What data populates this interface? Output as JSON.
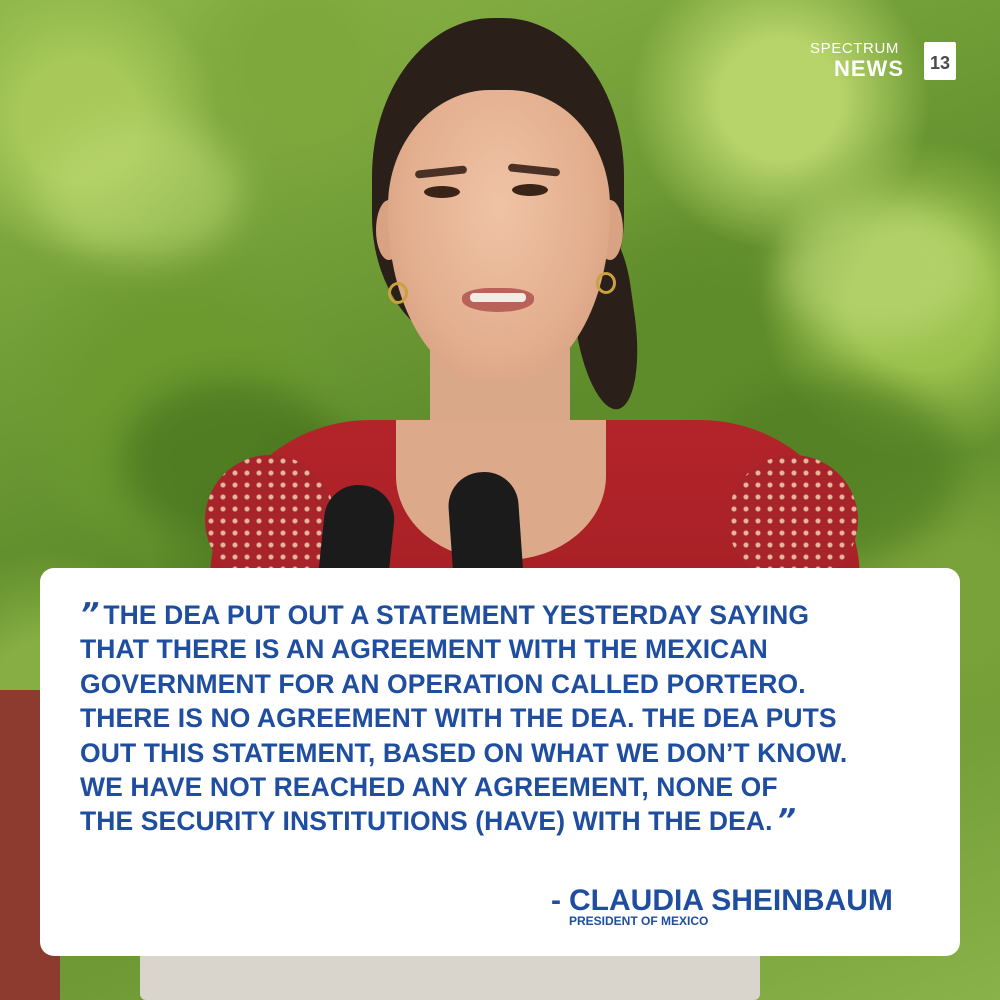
{
  "logo": {
    "line1": "SPECTRUM",
    "line2": "NEWS",
    "badge": "13"
  },
  "quote": {
    "open_mark": "”",
    "lines": [
      "THE DEA PUT OUT A STATEMENT YESTERDAY SAYING",
      "THAT THERE IS AN AGREEMENT WITH THE MEXICAN",
      "GOVERNMENT FOR AN OPERATION CALLED PORTERO.",
      "THERE IS NO AGREEMENT WITH THE DEA. THE DEA PUTS",
      "OUT THIS STATEMENT, BASED ON WHAT WE DON’T KNOW.",
      "WE HAVE NOT REACHED ANY AGREEMENT, NONE OF",
      "THE SECURITY INSTITUTIONS (HAVE) WITH THE DEA."
    ],
    "close_mark": "”",
    "color": "#1f4ea0"
  },
  "attribution": {
    "dash": "-",
    "name": "CLAUDIA SHEINBAUM",
    "title": "PRESIDENT OF MEXICO"
  }
}
